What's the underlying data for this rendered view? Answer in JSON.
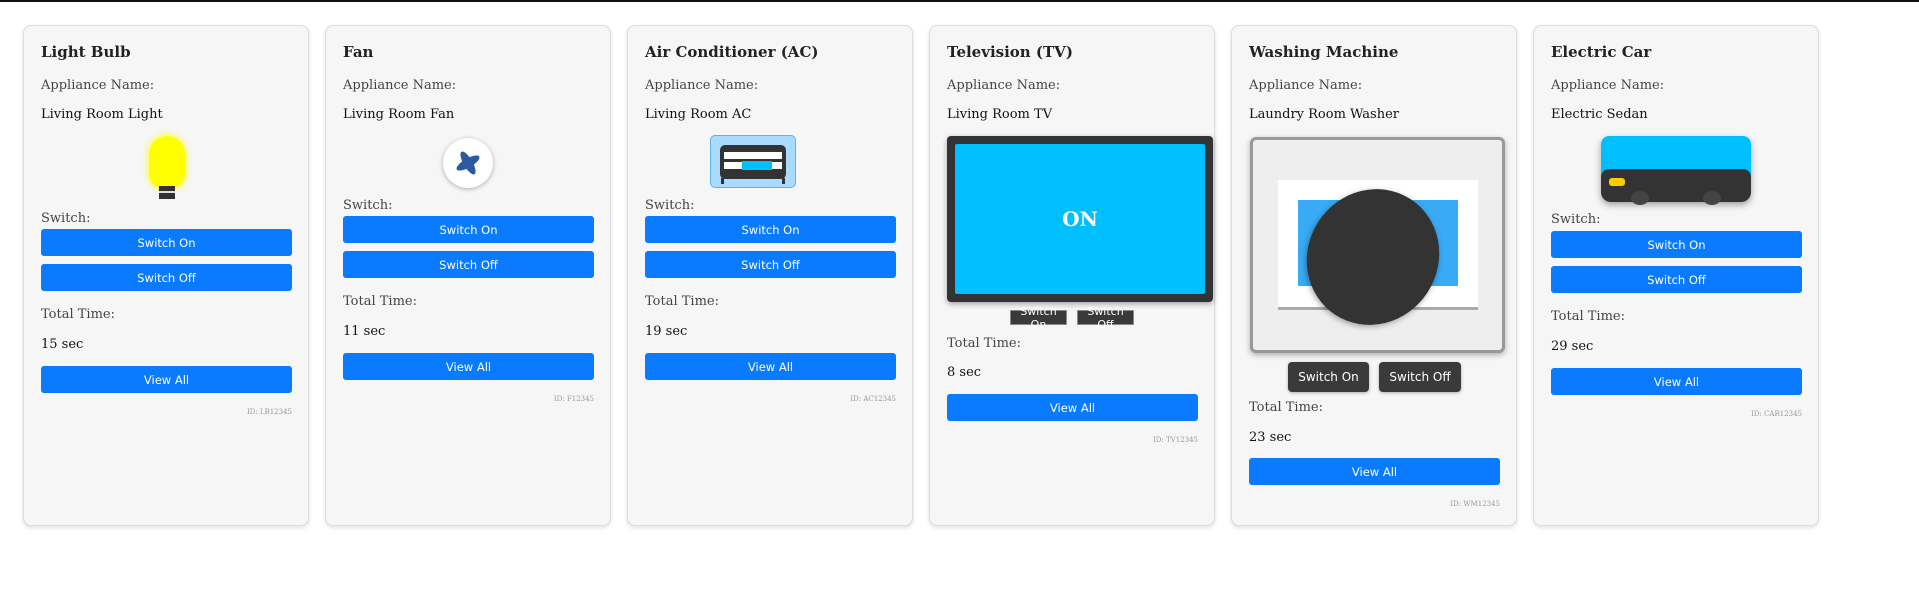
{
  "labels": {
    "appliance_name": "Appliance Name:",
    "switch": "Switch:",
    "total_time": "Total Time:",
    "switch_on": "Switch On",
    "switch_off": "Switch Off",
    "view_all": "View All"
  },
  "appliances": [
    {
      "title": "Light Bulb",
      "name": "Living Room Light",
      "time": "15 sec",
      "id": "ID: LB12345"
    },
    {
      "title": "Fan",
      "name": "Living Room Fan",
      "time": "11 sec",
      "id": "ID: F12345"
    },
    {
      "title": "Air Conditioner (AC)",
      "name": "Living Room AC",
      "time": "19 sec",
      "id": "ID: AC12345"
    },
    {
      "title": "Television (TV)",
      "name": "Living Room TV",
      "time": "8 sec",
      "id": "ID: TV12345",
      "screen_text": "ON"
    },
    {
      "title": "Washing Machine",
      "name": "Laundry Room Washer",
      "time": "23 sec",
      "id": "ID: WM12345"
    },
    {
      "title": "Electric Car",
      "name": "Electric Sedan",
      "time": "29 sec",
      "id": "ID: CAR12345"
    }
  ],
  "colors": {
    "button": "#0a7bff",
    "bulb": "#ffff00",
    "tv_screen": "#00bfff",
    "car_body": "#00bfff",
    "dark": "#333333"
  }
}
